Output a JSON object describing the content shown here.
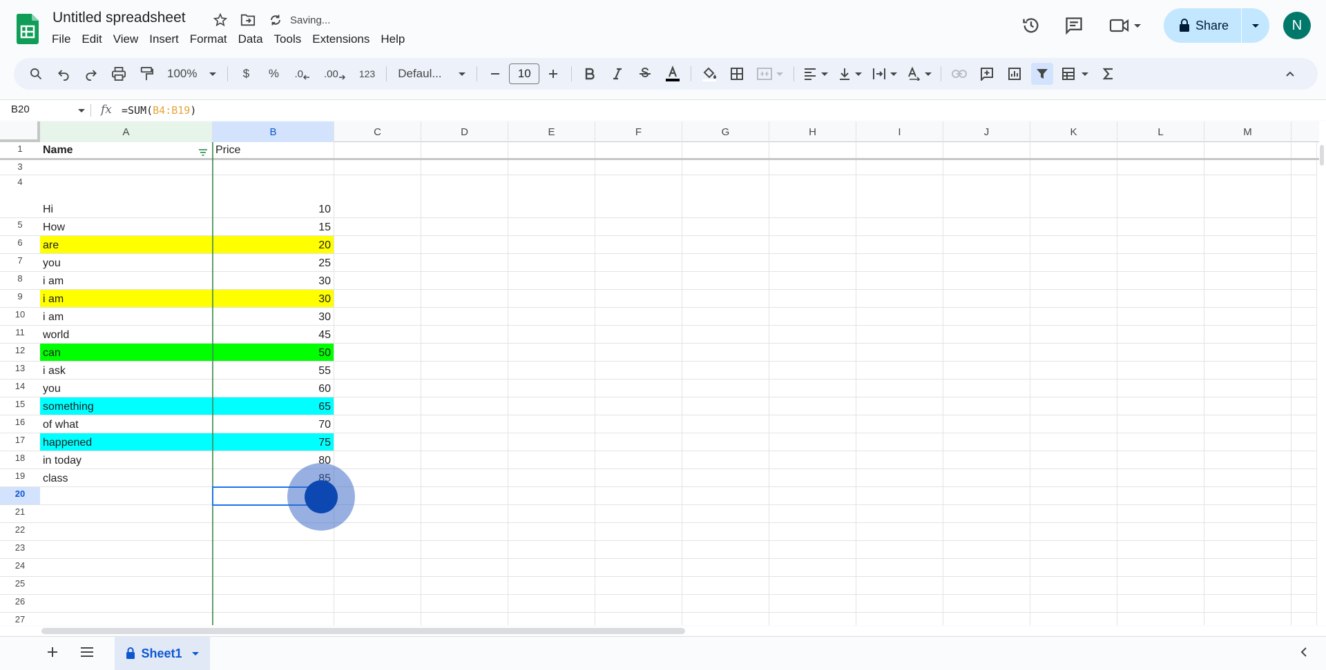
{
  "app": {
    "doc_title": "Untitled spreadsheet",
    "saving_status": "Saving...",
    "menu": [
      "File",
      "Edit",
      "View",
      "Insert",
      "Format",
      "Data",
      "Tools",
      "Extensions",
      "Help"
    ],
    "share_label": "Share",
    "avatar_initial": "N",
    "accent_color": "#0b57d0"
  },
  "toolbar": {
    "zoom": "100%",
    "currency": "$",
    "percent": "%",
    "dec_decrease": ".0",
    "dec_increase": ".00",
    "number_format": "123",
    "font_name": "Defaul...",
    "font_size": "10"
  },
  "formula_bar": {
    "name_box": "B20",
    "fx_label": "fx",
    "formula_prefix": "=SUM(",
    "formula_range": "B4:B19",
    "formula_suffix": ")"
  },
  "columns": [
    "A",
    "B",
    "C",
    "D",
    "E",
    "F",
    "G",
    "H",
    "I",
    "J",
    "K",
    "L",
    "M"
  ],
  "header_row": {
    "row": "1",
    "name": "Name",
    "price": "Price"
  },
  "rows": [
    {
      "row": "3",
      "name": "",
      "price": "",
      "fill": ""
    },
    {
      "row": "4",
      "name": "Hi",
      "price": "10",
      "fill": ""
    },
    {
      "row": "5",
      "name": "How",
      "price": "15",
      "fill": ""
    },
    {
      "row": "6",
      "name": "are",
      "price": "20",
      "fill": "#ffff00"
    },
    {
      "row": "7",
      "name": "you",
      "price": "25",
      "fill": ""
    },
    {
      "row": "8",
      "name": "i am",
      "price": "30",
      "fill": ""
    },
    {
      "row": "9",
      "name": "i am",
      "price": "30",
      "fill": "#ffff00"
    },
    {
      "row": "10",
      "name": "i am",
      "price": "30",
      "fill": ""
    },
    {
      "row": "11",
      "name": "world",
      "price": "45",
      "fill": ""
    },
    {
      "row": "12",
      "name": "can",
      "price": "50",
      "fill": "#00ff00"
    },
    {
      "row": "13",
      "name": "i ask",
      "price": "55",
      "fill": ""
    },
    {
      "row": "14",
      "name": "you",
      "price": "60",
      "fill": ""
    },
    {
      "row": "15",
      "name": "something",
      "price": "65",
      "fill": "#00ffff"
    },
    {
      "row": "16",
      "name": "of what",
      "price": "70",
      "fill": ""
    },
    {
      "row": "17",
      "name": "happened",
      "price": "75",
      "fill": "#00ffff"
    },
    {
      "row": "18",
      "name": "in today",
      "price": "80",
      "fill": ""
    },
    {
      "row": "19",
      "name": "class",
      "price": "85",
      "fill": ""
    },
    {
      "row": "20",
      "name": "",
      "price": "",
      "fill": ""
    },
    {
      "row": "21",
      "name": "",
      "price": "",
      "fill": ""
    },
    {
      "row": "22",
      "name": "",
      "price": "",
      "fill": ""
    },
    {
      "row": "23",
      "name": "",
      "price": "",
      "fill": ""
    },
    {
      "row": "24",
      "name": "",
      "price": "",
      "fill": ""
    },
    {
      "row": "25",
      "name": "",
      "price": "",
      "fill": ""
    },
    {
      "row": "26",
      "name": "",
      "price": "",
      "fill": ""
    },
    {
      "row": "27",
      "name": "",
      "price": "",
      "fill": ""
    }
  ],
  "selected_row": "20",
  "sheet_tab": "Sheet1"
}
